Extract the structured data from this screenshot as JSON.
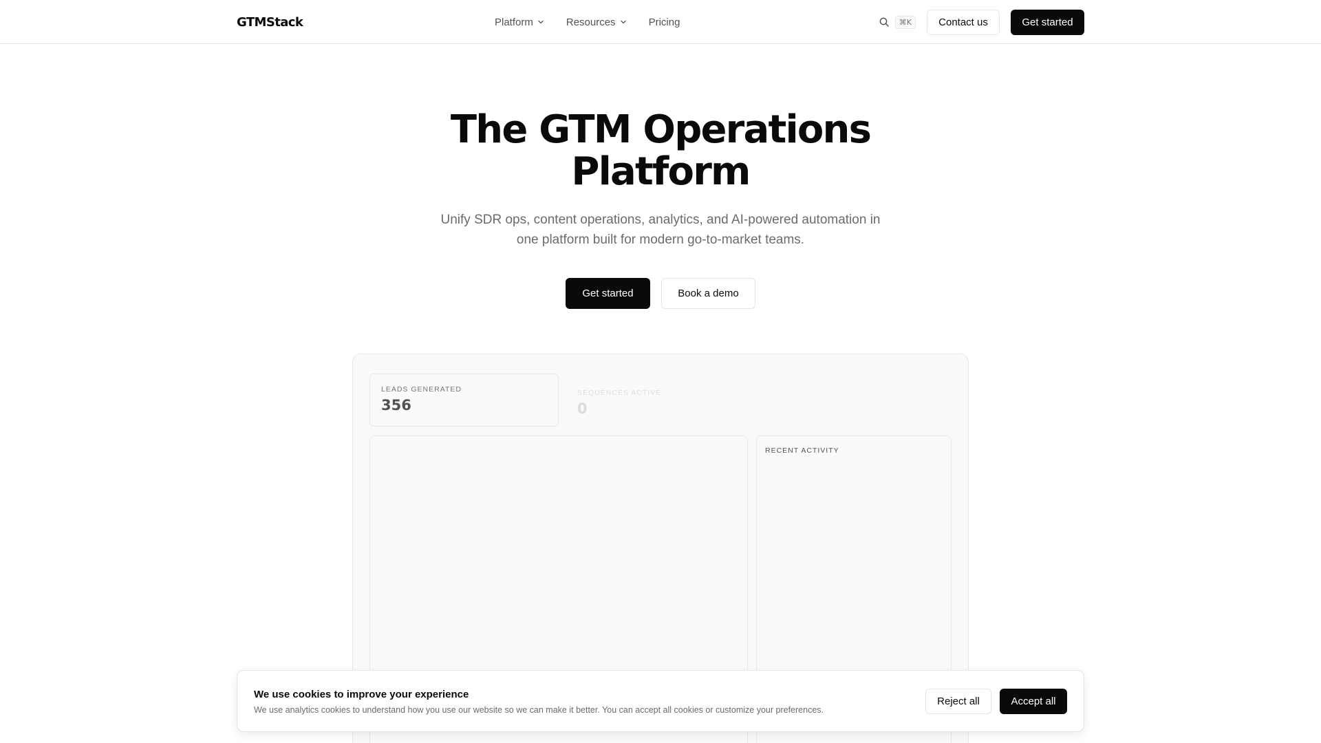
{
  "header": {
    "logo": "GTMStack",
    "nav": [
      {
        "label": "Platform",
        "has_dropdown": true
      },
      {
        "label": "Resources",
        "has_dropdown": true
      },
      {
        "label": "Pricing",
        "has_dropdown": false
      }
    ],
    "search_icon": "search-icon",
    "shortcut": "⌘K",
    "contact_label": "Contact us",
    "get_started_label": "Get started"
  },
  "hero": {
    "title_line1": "The GTM Operations",
    "title_line2": "Platform",
    "subtitle_line1": "Unify SDR ops, content operations, analytics, and AI-powered automation in",
    "subtitle_line2": "one platform built for modern go-to-market teams.",
    "primary_cta": "Get started",
    "secondary_cta": "Book a demo"
  },
  "dashboard": {
    "stats": [
      {
        "label": "LEADS GENERATED",
        "value": "356"
      },
      {
        "label": "SEQUENCES ACTIVE",
        "value": "0"
      }
    ],
    "recent_activity_title": "RECENT ACTIVITY"
  },
  "cookie_banner": {
    "title": "We use cookies to improve your experience",
    "text": "We use analytics cookies to understand how you use our website so we can make it better. You can accept all cookies or customize your preferences.",
    "reject_label": "Reject all",
    "accept_label": "Accept all"
  },
  "colors": {
    "primary": "#0a0a0a",
    "muted_text": "#6b6b6b",
    "border": "#e5e5e5",
    "panel_bg": "#fafafa"
  }
}
